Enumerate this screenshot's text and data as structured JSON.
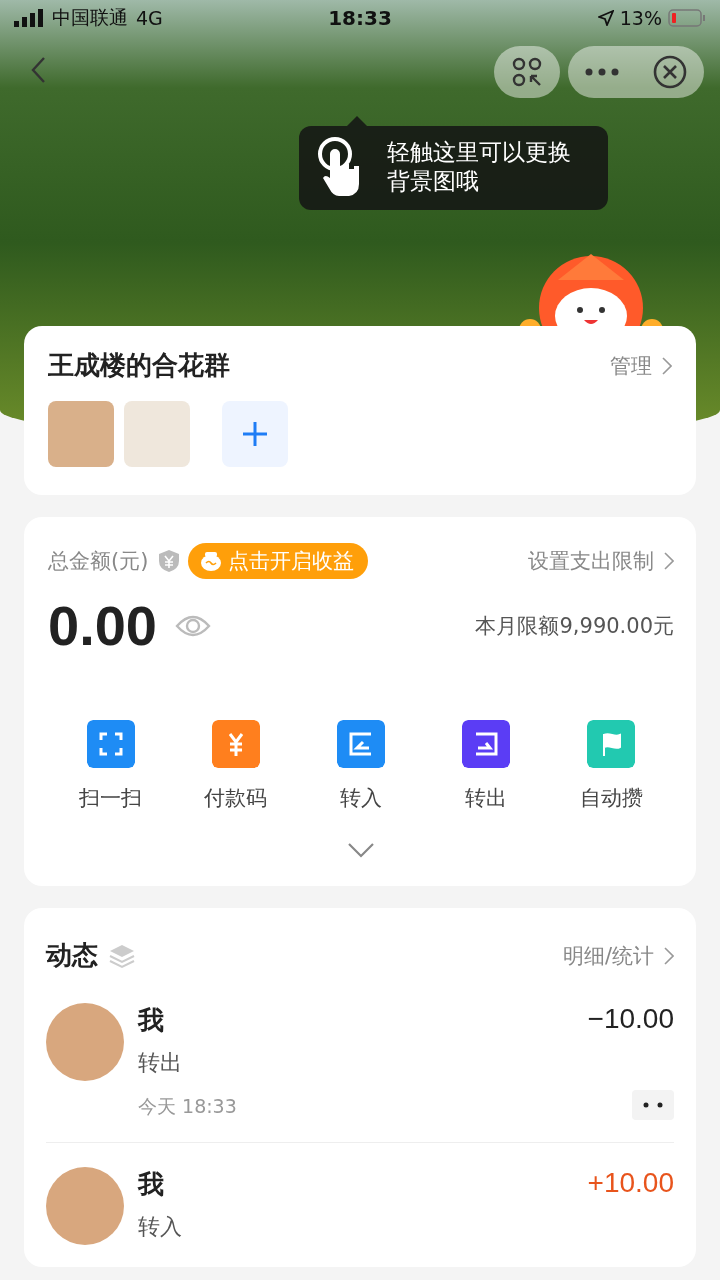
{
  "status_bar": {
    "carrier": "中国联通",
    "network": "4G",
    "time": "18:33",
    "battery": "13%"
  },
  "tooltip": {
    "text": "轻触这里可以更换背景图哦"
  },
  "group": {
    "title": "王成楼的合花群",
    "manage": "管理"
  },
  "balance": {
    "label": "总金额(元)",
    "promo": "点击开启收益",
    "limit_link": "设置支出限制",
    "amount": "0.00",
    "monthly_limit": "本月限额9,990.00元"
  },
  "actions": [
    {
      "label": "扫一扫",
      "kind": "scan",
      "color": "#1e8cf5"
    },
    {
      "label": "付款码",
      "kind": "pay",
      "color": "#ff7f1e"
    },
    {
      "label": "转入",
      "kind": "in",
      "color": "#1e8cf5"
    },
    {
      "label": "转出",
      "kind": "out",
      "color": "#5b3df5"
    },
    {
      "label": "自动攒",
      "kind": "flag",
      "color": "#22c9b0"
    }
  ],
  "activity": {
    "title": "动态",
    "link": "明细/统计",
    "items": [
      {
        "name": "我",
        "type": "转出",
        "time": "今天 18:33",
        "amount": "−10.00",
        "kind": "out"
      },
      {
        "name": "我",
        "type": "转入",
        "amount": "+10.00",
        "kind": "in"
      }
    ]
  }
}
